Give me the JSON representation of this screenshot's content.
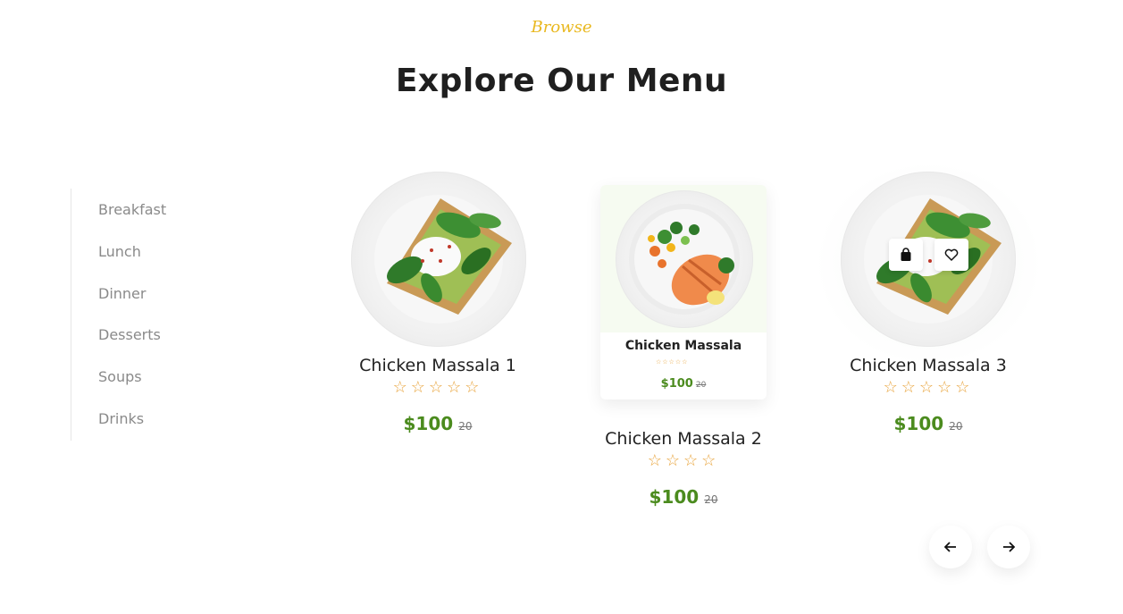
{
  "header": {
    "eyebrow": "Browse",
    "title": "Explore Our Menu"
  },
  "sidebar": {
    "items": [
      {
        "label": "Breakfast"
      },
      {
        "label": "Lunch"
      },
      {
        "label": "Dinner"
      },
      {
        "label": "Desserts"
      },
      {
        "label": "Soups"
      },
      {
        "label": "Drinks"
      }
    ]
  },
  "cards": [
    {
      "name": "Chicken Massala 1",
      "stars": "☆☆☆☆☆",
      "price": "$100",
      "old_price": "20",
      "image": "avocado-toast-plate"
    },
    {
      "name": "Chicken Massala 2",
      "stars": "☆☆☆☆",
      "price": "$100",
      "old_price": "20",
      "image": "salmon-vegetables-plate"
    },
    {
      "name": "Chicken Massala 3",
      "stars": "☆☆☆☆☆",
      "price": "$100",
      "old_price": "20",
      "image": "avocado-toast-plate"
    }
  ],
  "popup": {
    "name": "Chicken Massala",
    "stars": "☆☆☆☆☆",
    "price": "$100",
    "old_price": "20"
  },
  "actions": {
    "cart_icon": "shopping-bag-icon",
    "wishlist_icon": "heart-icon"
  },
  "navigation": {
    "prev_icon": "arrow-left-icon",
    "next_icon": "arrow-right-icon"
  },
  "colors": {
    "accent": "#e9b81f",
    "price": "#4b8b1e",
    "star": "#e8a33a",
    "title": "#1f1f1f",
    "sidebar_text": "#8a8a8a"
  }
}
